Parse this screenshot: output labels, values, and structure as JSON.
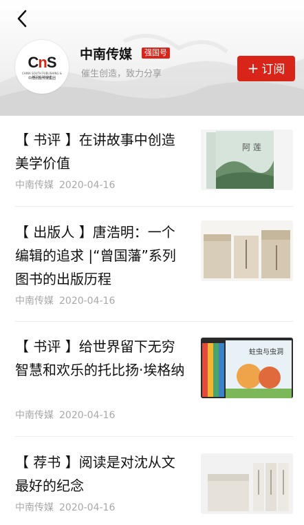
{
  "header": {
    "publisher_name": "中南传媒",
    "badge": "强国号",
    "slogan": "催生创造，致力分享",
    "subscribe_label": "订阅",
    "logo": {
      "mark": "CnS",
      "sub_en": "CHINA SOUTH PUBLISHING & MEDIA GROUP",
      "sub_cn": "中南出版传媒集团"
    }
  },
  "articles": [
    {
      "title": "【 书评 】在讲故事中创造美学价值",
      "source": "中南传媒",
      "date": "2020-04-16",
      "thumb_icon": "book-cover-lotus-image"
    },
    {
      "title": "【 出版人 】唐浩明：一个编辑的追求 |“曾国藩”系列图书的出版历程",
      "source": "中南传媒",
      "date": "2020-04-16",
      "thumb_icon": "book-stack-image"
    },
    {
      "title": "【 书评 】给世界留下无穷智慧和欢乐的托比扬·埃格纳",
      "source": "中南传媒",
      "date": "2020-04-16",
      "thumb_icon": "children-books-image"
    },
    {
      "title": "【 荐书 】阅读是对沈从文最好的纪念",
      "source": "中南传媒",
      "date": "2020-04-16",
      "thumb_icon": "book-box-set-image"
    }
  ],
  "colors": {
    "accent": "#d9241a",
    "meta": "#a8a8a8"
  }
}
